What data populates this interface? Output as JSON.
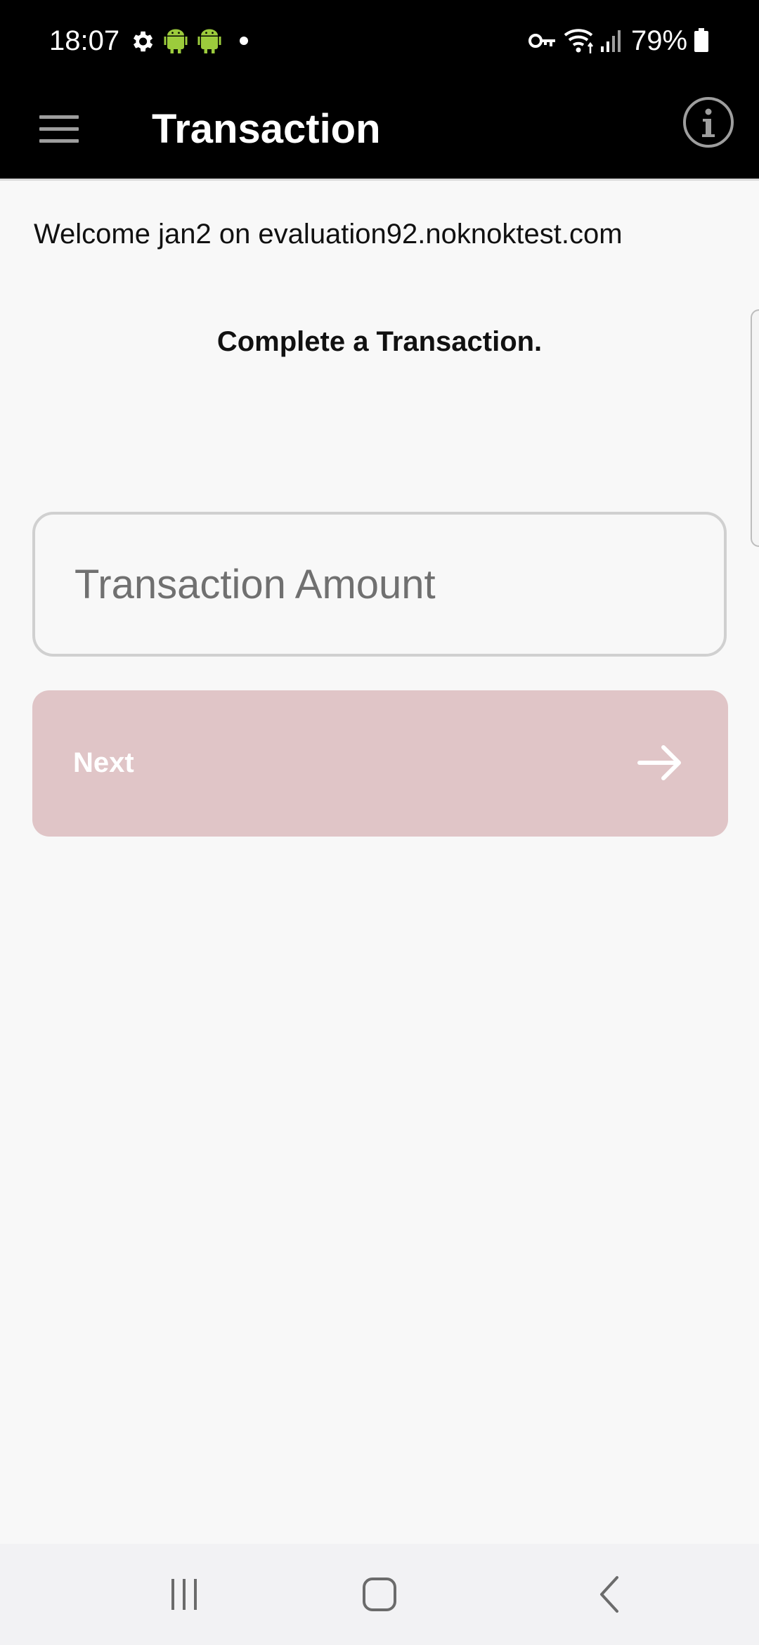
{
  "status_bar": {
    "time": "18:07",
    "battery": "79%",
    "left_icons": [
      "settings-gear-icon",
      "android-icon",
      "android-icon",
      "notification-dot-icon"
    ],
    "right_icons": [
      "vpn-key-icon",
      "wifi-icon",
      "signal-icon",
      "battery-icon"
    ]
  },
  "app_bar": {
    "title": "Transaction",
    "menu_icon": "hamburger-menu-icon",
    "info_icon": "info-icon"
  },
  "content": {
    "welcome": "Welcome jan2 on evaluation92.noknoktest.com",
    "heading": "Complete a Transaction.",
    "amount_input": {
      "placeholder": "Transaction Amount",
      "value": ""
    },
    "next_button": {
      "label": "Next",
      "icon": "arrow-right-icon"
    }
  },
  "colors": {
    "app_bar_bg": "#000000",
    "page_bg": "#f8f8f8",
    "next_button_bg": "#e0c5c7",
    "input_border": "#d0d0d0"
  },
  "nav_bar": {
    "buttons": [
      "recents-icon",
      "home-icon",
      "back-icon"
    ]
  }
}
